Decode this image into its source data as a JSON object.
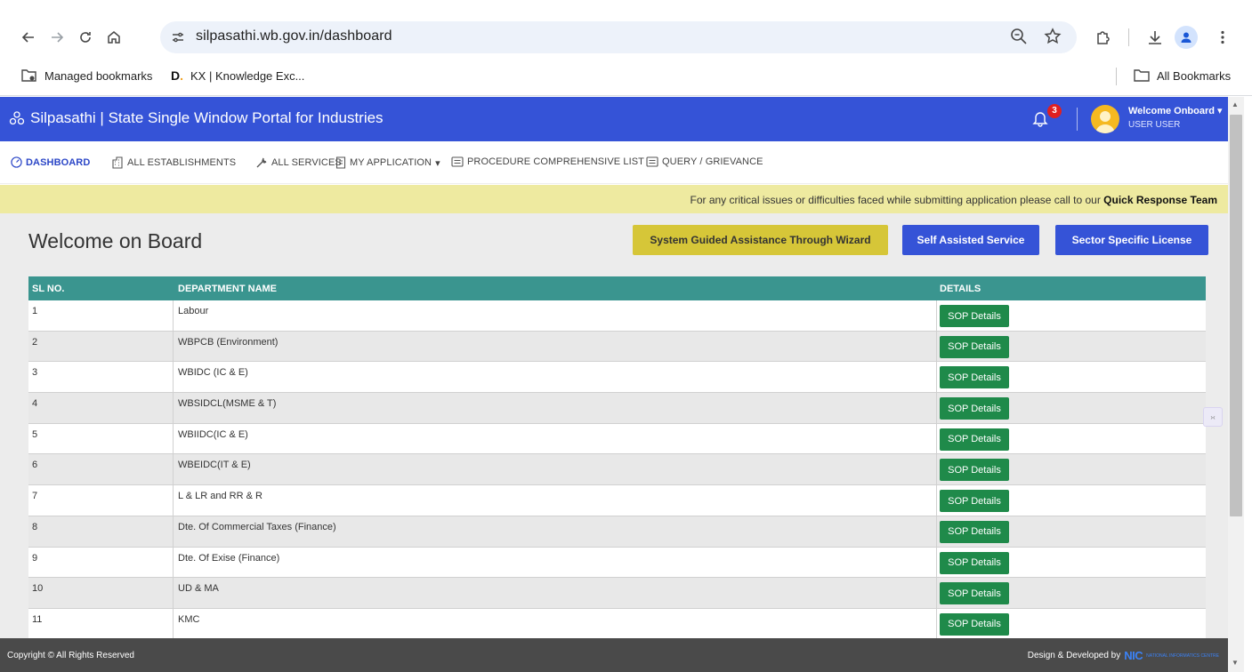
{
  "browser": {
    "url": "silpasathi.wb.gov.in/dashboard",
    "bookmarks": [
      "Managed bookmarks",
      "KX | Knowledge Exc..."
    ],
    "all_bookmarks": "All Bookmarks"
  },
  "header": {
    "title": "Silpasathi | State Single Window Portal for Industries",
    "notification_count": "3",
    "welcome": "Welcome Onboard",
    "user_role": "USER USER"
  },
  "nav": {
    "items": [
      "DASHBOARD",
      "ALL ESTABLISHMENTS",
      "ALL SERVICES",
      "MY APPLICATION",
      "PROCEDURE COMPREHENSIVE LIST",
      "QUERY / GRIEVANCE"
    ]
  },
  "notice": {
    "text": "For any critical issues or difficulties faced while submitting application please call to our ",
    "link": "Quick Response Team"
  },
  "main": {
    "title": "Welcome on Board",
    "buttons": [
      "System Guided Assistance Through Wizard",
      "Self Assisted Service",
      "Sector Specific License"
    ]
  },
  "table": {
    "headers": [
      "SL NO.",
      "DEPARTMENT NAME",
      "DETAILS"
    ],
    "rows": [
      {
        "sl": "1",
        "dept": "Labour",
        "action": "SOP Details"
      },
      {
        "sl": "2",
        "dept": "WBPCB (Environment)",
        "action": "SOP Details"
      },
      {
        "sl": "3",
        "dept": "WBIDC (IC & E)",
        "action": "SOP Details"
      },
      {
        "sl": "4",
        "dept": "WBSIDCL(MSME & T)",
        "action": "SOP Details"
      },
      {
        "sl": "5",
        "dept": "WBIIDC(IC & E)",
        "action": "SOP Details"
      },
      {
        "sl": "6",
        "dept": "WBEIDC(IT & E)",
        "action": "SOP Details"
      },
      {
        "sl": "7",
        "dept": "L & LR and RR & R",
        "action": "SOP Details"
      },
      {
        "sl": "8",
        "dept": "Dte. Of Commercial Taxes (Finance)",
        "action": "SOP Details"
      },
      {
        "sl": "9",
        "dept": "Dte. Of Exise (Finance)",
        "action": "SOP Details"
      },
      {
        "sl": "10",
        "dept": "UD & MA",
        "action": "SOP Details"
      },
      {
        "sl": "11",
        "dept": "KMC",
        "action": "SOP Details"
      }
    ]
  },
  "footer": {
    "copyright": "Copyright © All Rights Reserved",
    "developed_by": "Design & Developed by",
    "nic": "NIC",
    "nic_sub": "NATIONAL INFORMATICS CENTRE"
  },
  "colors": {
    "header_blue": "#3553d7",
    "table_header_teal": "#3a958f",
    "sop_green": "#1f8a4a",
    "notice_yellow": "#eeeaa0",
    "wizard_button": "#d6c638"
  }
}
